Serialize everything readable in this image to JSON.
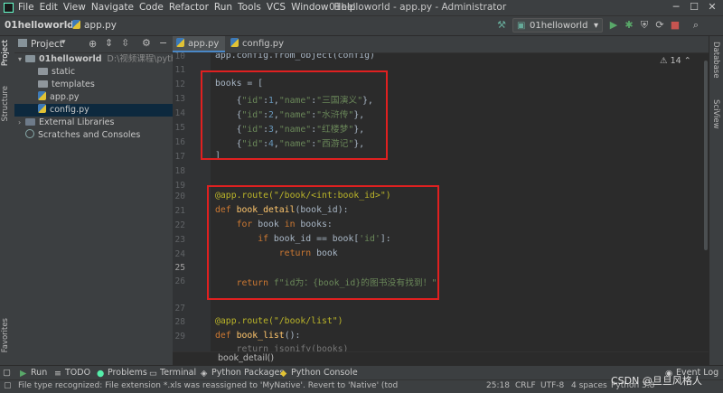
{
  "menu": {
    "items": [
      "File",
      "Edit",
      "View",
      "Navigate",
      "Code",
      "Refactor",
      "Run",
      "Tools",
      "VCS",
      "Window",
      "Help"
    ],
    "window_title": "01helloworld - app.py - Administrator"
  },
  "toolbar": {
    "crumb_project": "01helloworld",
    "crumb_file": "app.py",
    "run_config": "01helloworld"
  },
  "sidebar_tabs": {
    "left_top": [
      "Project",
      "Structure"
    ],
    "left_bottom": "Favorites",
    "right": [
      "Database",
      "SciView"
    ]
  },
  "project": {
    "header": "Project",
    "tree": [
      {
        "label": "01helloworld",
        "detail": "D:\\视频课程\\python\\",
        "type": "root"
      },
      {
        "label": "static",
        "type": "folder"
      },
      {
        "label": "templates",
        "type": "folder"
      },
      {
        "label": "app.py",
        "type": "py"
      },
      {
        "label": "config.py",
        "type": "py",
        "selected": true
      },
      {
        "label": "External Libraries",
        "type": "lib"
      },
      {
        "label": "Scratches and Consoles",
        "type": "scratch"
      }
    ]
  },
  "editor": {
    "tabs": [
      {
        "label": "app.py",
        "active": true
      },
      {
        "label": "config.py",
        "active": false
      }
    ],
    "warning_count": "14",
    "line_numbers": [
      "10",
      "11",
      "12",
      "13",
      "14",
      "15",
      "16",
      "17",
      "18",
      "19",
      "20",
      "21",
      "22",
      "23",
      "24",
      "25",
      "26",
      "27",
      "28",
      "29"
    ],
    "lines": {
      "l10": "app.config.from_object(config)",
      "books_open": "books = [",
      "book1_id": "1",
      "book1_name": "三国演义",
      "book2_id": "2",
      "book2_name": "水浒传",
      "book3_id": "3",
      "book3_name": "红楼梦",
      "book4_id": "4",
      "book4_name": "西游记",
      "books_close": "]",
      "route1": "@app.route(\"/book/<int:book_id>\")",
      "def1_name": "book_detail",
      "def1_param": "book_id",
      "for_line": "books",
      "if_key": "'id'",
      "return_book": "book",
      "fstring": "f\"id为：{book_id}的图书没有找到！\"",
      "route2": "@app.route(\"/book/list\")",
      "def2_name": "book_list",
      "partial": "return jsonify(books)"
    },
    "breadcrumb": "book_detail()"
  },
  "bottom_tabs": [
    "Run",
    "TODO",
    "Problems",
    "Terminal",
    "Python Packages",
    "Python Console",
    "Event Log"
  ],
  "status": {
    "message": "File type recognized: File extension *.xls was reassigned to 'MyNative'. Revert to 'Native' (today 10:47)",
    "position": "25:18",
    "line_sep": "CRLF",
    "encoding": "UTF-8",
    "indent": "4 spaces",
    "interpreter": "Python 3.8",
    "watermark": "CSDN @旦旦风格人"
  },
  "colors": {
    "background": "#2b2b2b",
    "highlight_box": "#e02020",
    "selection": "#0d293e"
  }
}
